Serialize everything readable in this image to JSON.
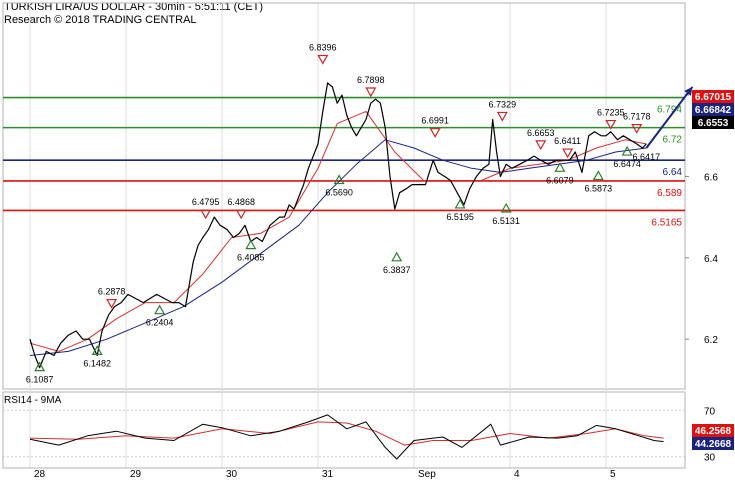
{
  "header": {
    "title": "TURKISH LIRA/US DOLLAR - 30min - 5:51:11 (CET)",
    "subtitle": "Research © 2018 TRADING CENTRAL"
  },
  "colors": {
    "resistance": "#2e8b2e",
    "pivot": "#1a237e",
    "support": "#dd1111",
    "price": "#000000",
    "ma_fast": "#d32f2f",
    "ma_slow": "#1a237e",
    "rsi": "#000000",
    "rsi_ma": "#d32f2f",
    "arrow": "#1a237e",
    "marker_up": "#2e7d32",
    "marker_down": "#c62828"
  },
  "chart_data": [
    {
      "type": "line",
      "name": "price",
      "ylim": [
        6.08,
        6.96
      ],
      "y_ticks": [
        "6.8",
        "6.6",
        "6.4",
        "6.2"
      ],
      "x_ticks": [
        "28",
        "29",
        "30",
        "31",
        "Sep",
        "4",
        "5"
      ],
      "x_tick_days": [
        0,
        1,
        2,
        3,
        4,
        5,
        6
      ],
      "series": [
        {
          "points": [
            [
              0.0,
              6.2
            ],
            [
              0.05,
              6.16
            ],
            [
              0.1,
              6.13
            ],
            [
              0.17,
              6.17
            ],
            [
              0.25,
              6.16
            ],
            [
              0.32,
              6.19
            ],
            [
              0.4,
              6.21
            ],
            [
              0.48,
              6.22
            ],
            [
              0.55,
              6.2
            ],
            [
              0.62,
              6.2
            ],
            [
              0.7,
              6.16
            ],
            [
              0.75,
              6.22
            ],
            [
              0.82,
              6.26
            ],
            [
              0.88,
              6.28
            ],
            [
              0.95,
              6.29
            ],
            [
              1.02,
              6.31
            ],
            [
              1.1,
              6.3
            ],
            [
              1.18,
              6.29
            ],
            [
              1.25,
              6.3
            ],
            [
              1.32,
              6.31
            ],
            [
              1.4,
              6.3
            ],
            [
              1.48,
              6.29
            ],
            [
              1.55,
              6.29
            ],
            [
              1.62,
              6.28
            ],
            [
              1.7,
              6.39
            ],
            [
              1.75,
              6.43
            ],
            [
              1.8,
              6.45
            ],
            [
              1.86,
              6.47
            ],
            [
              1.92,
              6.5
            ],
            [
              1.98,
              6.48
            ],
            [
              2.05,
              6.47
            ],
            [
              2.12,
              6.45
            ],
            [
              2.18,
              6.46
            ],
            [
              2.24,
              6.48
            ],
            [
              2.3,
              6.44
            ],
            [
              2.36,
              6.45
            ],
            [
              2.42,
              6.44
            ],
            [
              2.5,
              6.48
            ],
            [
              2.55,
              6.49
            ],
            [
              2.6,
              6.5
            ],
            [
              2.65,
              6.5
            ],
            [
              2.7,
              6.53
            ],
            [
              2.75,
              6.52
            ],
            [
              2.8,
              6.55
            ],
            [
              2.85,
              6.58
            ],
            [
              2.9,
              6.62
            ],
            [
              2.95,
              6.65
            ],
            [
              3.0,
              6.68
            ],
            [
              3.05,
              6.76
            ],
            [
              3.1,
              6.83
            ],
            [
              3.15,
              6.82
            ],
            [
              3.2,
              6.78
            ],
            [
              3.25,
              6.8
            ],
            [
              3.3,
              6.75
            ],
            [
              3.35,
              6.72
            ],
            [
              3.4,
              6.7
            ],
            [
              3.45,
              6.72
            ],
            [
              3.5,
              6.74
            ],
            [
              3.55,
              6.78
            ],
            [
              3.6,
              6.79
            ],
            [
              3.65,
              6.78
            ],
            [
              3.7,
              6.72
            ],
            [
              3.75,
              6.6
            ],
            [
              3.8,
              6.52
            ],
            [
              3.85,
              6.56
            ],
            [
              3.92,
              6.57
            ],
            [
              3.98,
              6.58
            ],
            [
              4.05,
              6.58
            ],
            [
              4.12,
              6.58
            ],
            [
              4.2,
              6.64
            ],
            [
              4.25,
              6.61
            ],
            [
              4.32,
              6.6
            ],
            [
              4.38,
              6.59
            ],
            [
              4.45,
              6.56
            ],
            [
              4.52,
              6.53
            ],
            [
              4.58,
              6.57
            ],
            [
              4.65,
              6.6
            ],
            [
              4.72,
              6.62
            ],
            [
              4.78,
              6.63
            ],
            [
              4.82,
              6.74
            ],
            [
              4.86,
              6.66
            ],
            [
              4.9,
              6.6
            ],
            [
              4.96,
              6.63
            ],
            [
              5.02,
              6.62
            ],
            [
              5.1,
              6.63
            ],
            [
              5.18,
              6.64
            ],
            [
              5.25,
              6.65
            ],
            [
              5.32,
              6.64
            ],
            [
              5.4,
              6.63
            ],
            [
              5.48,
              6.64
            ],
            [
              5.55,
              6.64
            ],
            [
              5.62,
              6.64
            ],
            [
              5.68,
              6.66
            ],
            [
              5.75,
              6.61
            ],
            [
              5.82,
              6.7
            ],
            [
              5.88,
              6.71
            ],
            [
              5.95,
              6.7
            ],
            [
              6.0,
              6.7
            ],
            [
              6.05,
              6.71
            ],
            [
              6.12,
              6.69
            ],
            [
              6.18,
              6.7
            ],
            [
              6.25,
              6.69
            ],
            [
              6.32,
              6.68
            ],
            [
              6.38,
              6.67
            ],
            [
              6.42,
              6.68
            ]
          ]
        },
        {
          "points": [
            [
              0.0,
              6.19
            ],
            [
              0.3,
              6.17
            ],
            [
              0.6,
              6.2
            ],
            [
              0.9,
              6.25
            ],
            [
              1.2,
              6.29
            ],
            [
              1.5,
              6.29
            ],
            [
              1.8,
              6.36
            ],
            [
              2.1,
              6.45
            ],
            [
              2.4,
              6.46
            ],
            [
              2.7,
              6.5
            ],
            [
              3.0,
              6.62
            ],
            [
              3.2,
              6.73
            ],
            [
              3.5,
              6.76
            ],
            [
              3.8,
              6.66
            ],
            [
              4.1,
              6.59
            ],
            [
              4.4,
              6.59
            ],
            [
              4.7,
              6.59
            ],
            [
              5.0,
              6.62
            ],
            [
              5.3,
              6.63
            ],
            [
              5.6,
              6.64
            ],
            [
              5.9,
              6.67
            ],
            [
              6.2,
              6.69
            ],
            [
              6.42,
              6.68
            ]
          ]
        },
        {
          "points": [
            [
              0.0,
              6.16
            ],
            [
              0.4,
              6.17
            ],
            [
              0.8,
              6.2
            ],
            [
              1.2,
              6.24
            ],
            [
              1.6,
              6.28
            ],
            [
              2.0,
              6.34
            ],
            [
              2.4,
              6.41
            ],
            [
              2.8,
              6.48
            ],
            [
              3.1,
              6.56
            ],
            [
              3.4,
              6.63
            ],
            [
              3.7,
              6.69
            ],
            [
              4.0,
              6.67
            ],
            [
              4.3,
              6.64
            ],
            [
              4.6,
              6.62
            ],
            [
              4.9,
              6.61
            ],
            [
              5.2,
              6.62
            ],
            [
              5.5,
              6.63
            ],
            [
              5.8,
              6.64
            ],
            [
              6.1,
              6.66
            ],
            [
              6.42,
              6.67
            ]
          ]
        }
      ],
      "levels": [
        {
          "value": 6.794,
          "label": "6.794",
          "kind": "resistance"
        },
        {
          "value": 6.72,
          "label": "6.72",
          "kind": "resistance"
        },
        {
          "value": 6.64,
          "label": "6.64",
          "kind": "pivot"
        },
        {
          "value": 6.589,
          "label": "6.589",
          "kind": "support"
        },
        {
          "value": 6.5165,
          "label": "6.5165",
          "kind": "support"
        }
      ],
      "price_tags": [
        {
          "label": "6.67015",
          "value": 6.67015,
          "color": "#dd1111"
        },
        {
          "label": "6.66842",
          "value": 6.66842,
          "color": "#1a237e"
        },
        {
          "label": "6.6553",
          "value": 6.6553,
          "color": "#000000"
        }
      ],
      "annotations": [
        {
          "label": "6.1087",
          "x": 0.1,
          "y": 6.13,
          "marker": "up"
        },
        {
          "label": "6.1482",
          "x": 0.7,
          "y": 6.17,
          "marker": "up"
        },
        {
          "label": "6.2878",
          "x": 0.85,
          "y": 6.29,
          "marker": "down"
        },
        {
          "label": "6.2404",
          "x": 1.35,
          "y": 6.27,
          "marker": "up"
        },
        {
          "label": "6.4795",
          "x": 1.83,
          "y": 6.51,
          "marker": "down"
        },
        {
          "label": "6.4868",
          "x": 2.2,
          "y": 6.51,
          "marker": "down"
        },
        {
          "label": "6.4085",
          "x": 2.3,
          "y": 6.43,
          "marker": "up"
        },
        {
          "label": "6.8396",
          "x": 3.05,
          "y": 6.89,
          "marker": "down"
        },
        {
          "label": "6.5690",
          "x": 3.22,
          "y": 6.59,
          "marker": "up"
        },
        {
          "label": "6.7898",
          "x": 3.55,
          "y": 6.81,
          "marker": "down"
        },
        {
          "label": "6.3837",
          "x": 3.82,
          "y": 6.4,
          "marker": "up"
        },
        {
          "label": "6.6991",
          "x": 4.22,
          "y": 6.71,
          "marker": "down"
        },
        {
          "label": "6.5195",
          "x": 4.48,
          "y": 6.53,
          "marker": "up"
        },
        {
          "label": "6.7329",
          "x": 4.92,
          "y": 6.75,
          "marker": "down"
        },
        {
          "label": "6.5131",
          "x": 4.96,
          "y": 6.52,
          "marker": "up"
        },
        {
          "label": "6.6653",
          "x": 5.32,
          "y": 6.68,
          "marker": "down"
        },
        {
          "label": "6.6079",
          "x": 5.52,
          "y": 6.62,
          "marker": "up"
        },
        {
          "label": "6.6411",
          "x": 5.6,
          "y": 6.66,
          "marker": "down"
        },
        {
          "label": "6.5873",
          "x": 5.92,
          "y": 6.6,
          "marker": "up"
        },
        {
          "label": "6.7235",
          "x": 6.05,
          "y": 6.73,
          "marker": "down"
        },
        {
          "label": "6.6474",
          "x": 6.22,
          "y": 6.66,
          "marker": "up"
        },
        {
          "label": "6.7178",
          "x": 6.32,
          "y": 6.72,
          "marker": "down"
        },
        {
          "label": "6.6417",
          "x": 6.42,
          "y": 6.65,
          "marker": "none"
        }
      ],
      "forecast_arrow": [
        [
          6.42,
          6.67
        ],
        [
          6.9,
          6.82
        ]
      ]
    },
    {
      "type": "line",
      "name": "RSI14 - 9MA",
      "title": "RSI14 - 9MA",
      "ylim": [
        22,
        84
      ],
      "y_ticks": [
        "70",
        "30"
      ],
      "series": [
        {
          "name": "RSI14",
          "points": [
            [
              0.0,
              45
            ],
            [
              0.3,
              40
            ],
            [
              0.6,
              48
            ],
            [
              0.9,
              52
            ],
            [
              1.2,
              46
            ],
            [
              1.5,
              44
            ],
            [
              1.8,
              58
            ],
            [
              2.0,
              55
            ],
            [
              2.3,
              48
            ],
            [
              2.6,
              52
            ],
            [
              2.9,
              60
            ],
            [
              3.1,
              66
            ],
            [
              3.3,
              54
            ],
            [
              3.5,
              60
            ],
            [
              3.7,
              38
            ],
            [
              3.82,
              28
            ],
            [
              4.0,
              44
            ],
            [
              4.3,
              47
            ],
            [
              4.5,
              38
            ],
            [
              4.8,
              58
            ],
            [
              4.9,
              40
            ],
            [
              5.2,
              47
            ],
            [
              5.5,
              46
            ],
            [
              5.7,
              48
            ],
            [
              5.9,
              57
            ],
            [
              6.1,
              54
            ],
            [
              6.3,
              49
            ],
            [
              6.5,
              44
            ],
            [
              6.6,
              43
            ]
          ]
        },
        {
          "name": "9MA",
          "points": [
            [
              0.0,
              46
            ],
            [
              0.5,
              45
            ],
            [
              1.0,
              48
            ],
            [
              1.5,
              46
            ],
            [
              2.0,
              54
            ],
            [
              2.5,
              50
            ],
            [
              3.0,
              60
            ],
            [
              3.3,
              59
            ],
            [
              3.6,
              52
            ],
            [
              3.9,
              40
            ],
            [
              4.2,
              44
            ],
            [
              4.6,
              44
            ],
            [
              5.0,
              50
            ],
            [
              5.4,
              46
            ],
            [
              5.8,
              50
            ],
            [
              6.1,
              54
            ],
            [
              6.4,
              48
            ],
            [
              6.6,
              46
            ]
          ]
        }
      ],
      "value_tags": [
        {
          "label": "46.2568",
          "value": 46.2568,
          "color": "#dd1111"
        },
        {
          "label": "44.2668",
          "value": 44.2668,
          "color": "#1a237e"
        }
      ]
    }
  ]
}
